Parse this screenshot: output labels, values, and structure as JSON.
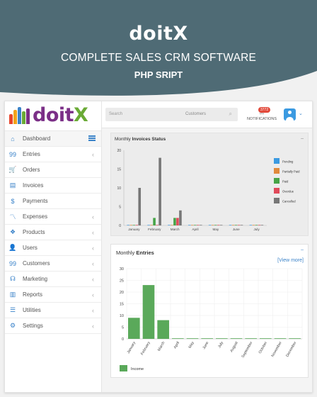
{
  "banner": {
    "title": "doitX",
    "subtitle": "COMPLETE SALES CRM SOFTWARE",
    "tagline": "PHP SRIPT",
    "color": "#4f6b75"
  },
  "logo": {
    "part1": "doit",
    "part2": "X",
    "bar_colors": [
      "#e8452c",
      "#f2a31b",
      "#3b83c9",
      "#6aaa35",
      "#7b2f87"
    ]
  },
  "sidebar": {
    "items": [
      {
        "label": "Dashboard",
        "icon": "home-icon",
        "glyph": "⌂",
        "chev": false,
        "active": true
      },
      {
        "label": "Entries",
        "icon": "quote-icon",
        "glyph": "99",
        "chev": true
      },
      {
        "label": "Orders",
        "icon": "cart-icon",
        "glyph": "🛒",
        "chev": false
      },
      {
        "label": "Invoices",
        "icon": "document-icon",
        "glyph": "▤",
        "chev": false
      },
      {
        "label": "Payments",
        "icon": "dollar-icon",
        "glyph": "$",
        "chev": false
      },
      {
        "label": "Expenses",
        "icon": "chart-line-icon",
        "glyph": "〽",
        "chev": true
      },
      {
        "label": "Products",
        "icon": "cube-icon",
        "glyph": "❖",
        "chev": true
      },
      {
        "label": "Users",
        "icon": "user-icon",
        "glyph": "👤",
        "chev": true
      },
      {
        "label": "Customers",
        "icon": "quote-icon",
        "glyph": "99",
        "chev": true
      },
      {
        "label": "Marketing",
        "icon": "headset-icon",
        "glyph": "☊",
        "chev": true
      },
      {
        "label": "Reports",
        "icon": "book-icon",
        "glyph": "▥",
        "chev": true
      },
      {
        "label": "Utilities",
        "icon": "list-icon",
        "glyph": "☰",
        "chev": true
      },
      {
        "label": "Settings",
        "icon": "gear-icon",
        "glyph": "⚙",
        "chev": true
      }
    ]
  },
  "topbar": {
    "search_placeholder": "Search",
    "search_scope": "Customers",
    "notification_count": "3772",
    "notifications_label": "NOTIFICATIONS"
  },
  "invoices_card": {
    "title_prefix": "Monthly",
    "title_bold": "Invoices Status",
    "minimize": "–"
  },
  "entries_card": {
    "title_prefix": "Monthly",
    "title_bold": "Entries",
    "minimize": "–",
    "view_more": "[View more]"
  },
  "chart_data": [
    {
      "type": "bar",
      "categories": [
        "January",
        "February",
        "March",
        "April",
        "May",
        "June",
        "July"
      ],
      "ylim": [
        0,
        20
      ],
      "yticks": [
        0,
        5,
        10,
        15,
        20
      ],
      "series": [
        {
          "name": "Pending",
          "color": "#3b9ae1",
          "values": [
            0,
            0,
            0,
            0,
            0,
            0,
            0
          ]
        },
        {
          "name": "Partially Paid",
          "color": "#e08a3c",
          "values": [
            0,
            0,
            0,
            0,
            0,
            0,
            0
          ]
        },
        {
          "name": "Paid",
          "color": "#47a447",
          "values": [
            0,
            2,
            2,
            0,
            0,
            0,
            0
          ]
        },
        {
          "name": "Overdue",
          "color": "#e04a5a",
          "values": [
            0,
            0,
            2,
            0,
            0,
            0,
            0
          ]
        },
        {
          "name": "Cancelled",
          "color": "#777777",
          "values": [
            10,
            18,
            4,
            0,
            0,
            0,
            0
          ]
        }
      ],
      "legend": "right"
    },
    {
      "type": "bar",
      "categories": [
        "January",
        "February",
        "March",
        "April",
        "May",
        "June",
        "July",
        "August",
        "September",
        "October",
        "November",
        "December"
      ],
      "ylim": [
        0,
        30
      ],
      "yticks": [
        0,
        5,
        10,
        15,
        20,
        25,
        30
      ],
      "series": [
        {
          "name": "Income",
          "color": "#5aa95a",
          "values": [
            9,
            23,
            8,
            0,
            0,
            0,
            0,
            0,
            0,
            0,
            0,
            0
          ]
        }
      ],
      "legend": "bottom-left"
    }
  ]
}
